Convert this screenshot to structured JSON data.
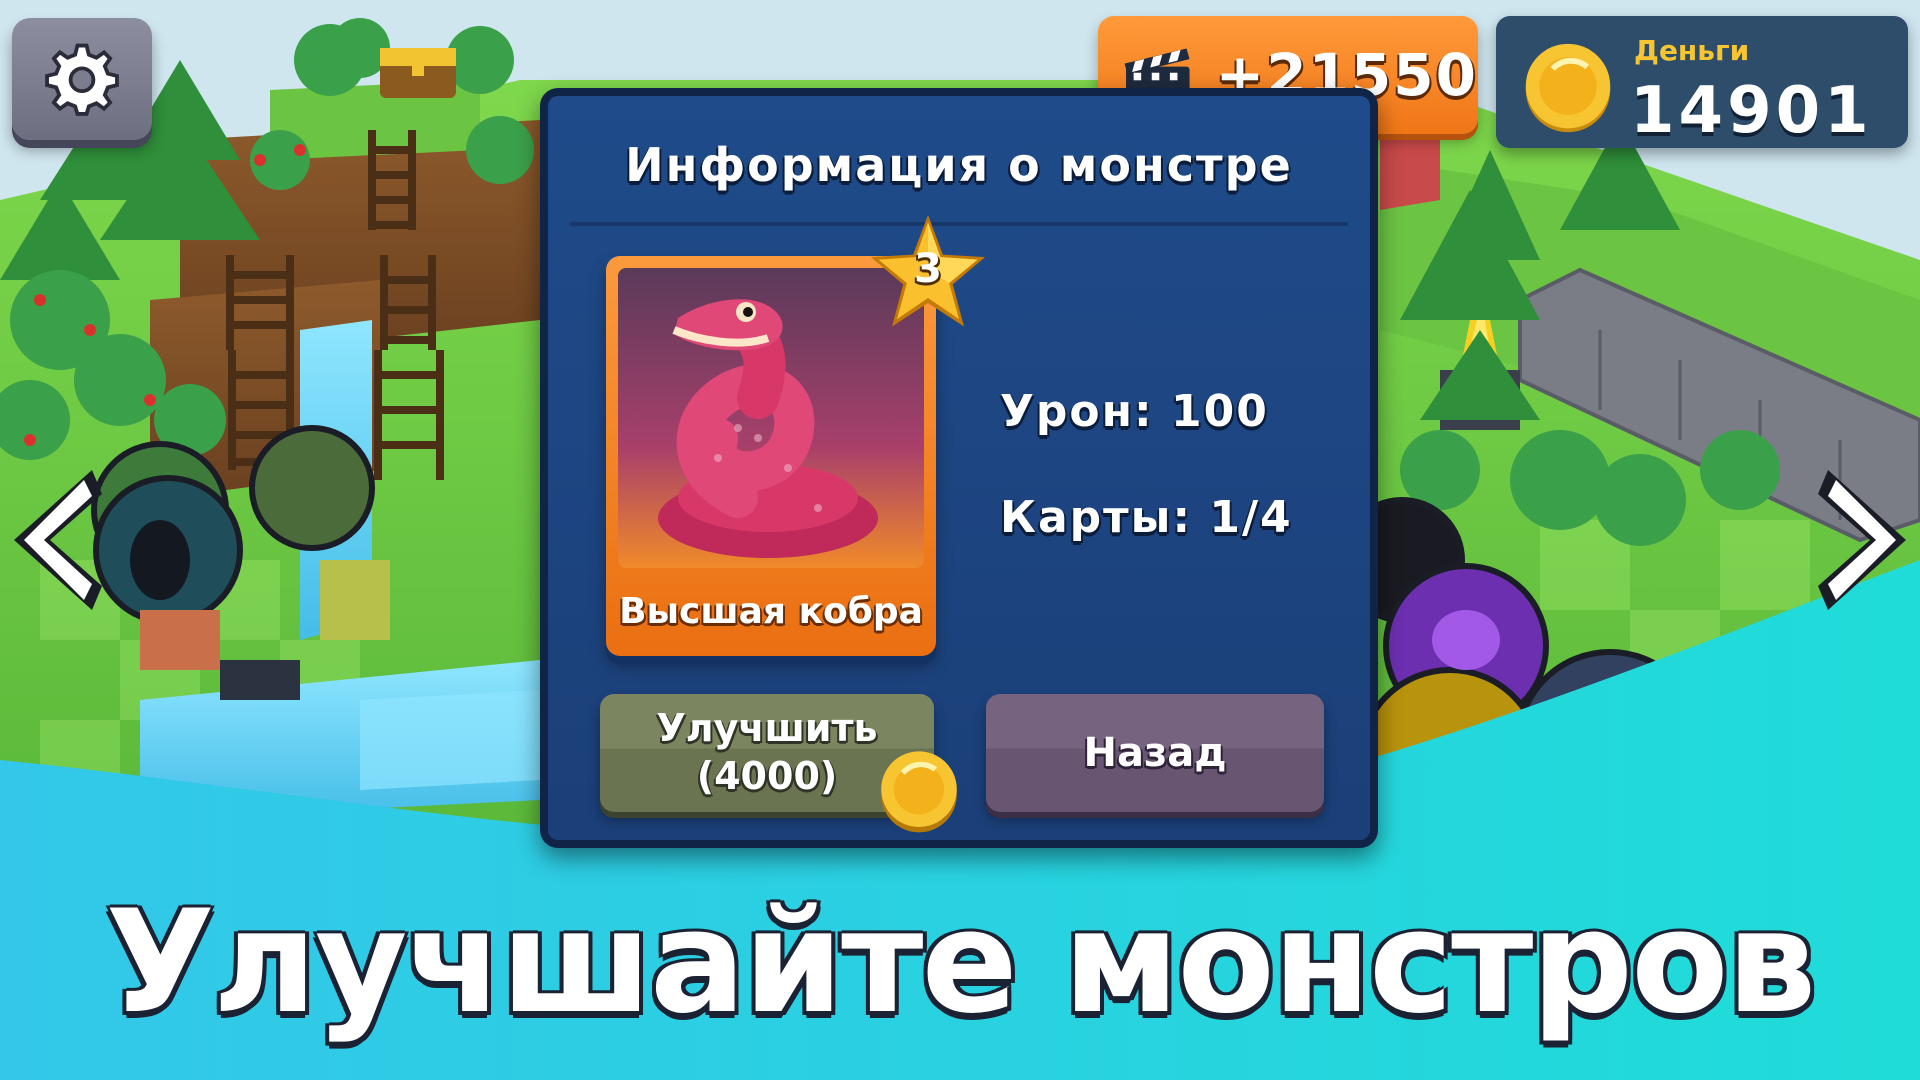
{
  "hud": {
    "video_reward": "+21550",
    "money_label": "Деньги",
    "money_value": "14901"
  },
  "dialog": {
    "title": "Информация о монстре",
    "card_name": "Высшая кобра",
    "level": "3",
    "damage": "Урон: 100",
    "cards": "Карты: 1/4",
    "upgrade_line1": "Улучшить",
    "upgrade_line2": "(4000)",
    "back": "Назад"
  },
  "promo": {
    "headline": "Улучшайте монстров"
  },
  "colors": {
    "dialog_bg": "#1f4b8a",
    "card_orange": "#f07617",
    "hud_orange": "#f07617",
    "hud_money_bg": "#2e4d6a",
    "coin_gold": "#f7c531",
    "promo_band": "#27d3e0"
  },
  "icons": [
    "gear-icon",
    "clapperboard-icon",
    "coin-icon",
    "star-icon",
    "chevron-left-icon",
    "chevron-right-icon"
  ]
}
